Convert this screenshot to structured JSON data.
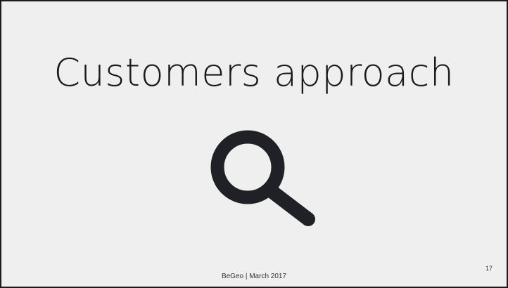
{
  "slide": {
    "title": "Customers approach",
    "icon": "search-icon",
    "footer": "BeGeo | March 2017",
    "page_number": "17"
  },
  "colors": {
    "background": "#efefef",
    "text": "#1a1a1a",
    "icon": "#1f2126",
    "border": "#1b1b1b"
  }
}
